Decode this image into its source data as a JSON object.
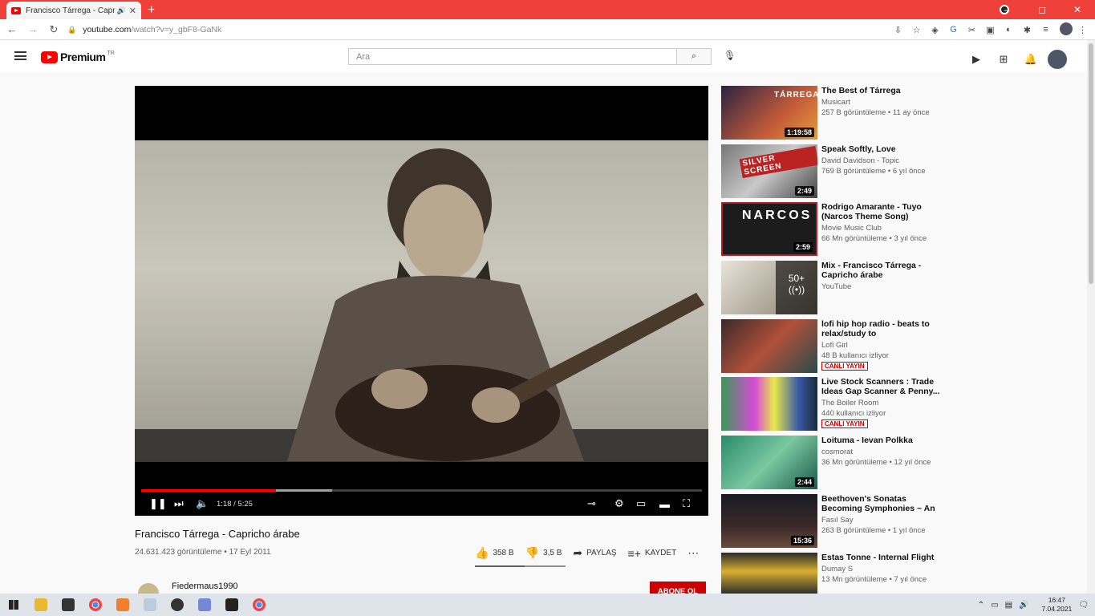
{
  "browser": {
    "tab_title": "Francisco Tárrega - Capricho",
    "url_host": "youtube.com",
    "url_path": "/watch?v=y_gbF8-GaNk",
    "window_controls": [
      "–",
      "◻",
      "✕"
    ]
  },
  "youtube": {
    "logo_text": "Premium",
    "logo_country": "TR",
    "search_placeholder": "Ara"
  },
  "player": {
    "current_time": "1:18",
    "duration": "5:25",
    "time_display": "1:18 / 5:25",
    "progress_fraction": 0.24,
    "buffered_fraction": 0.34
  },
  "video": {
    "title": "Francisco Tárrega - Capricho árabe",
    "meta": "24.631.423 görüntüleme • 17 Eyl 2011",
    "likes": "358 B",
    "dislikes": "3,5 B",
    "share_label": "PAYLAŞ",
    "save_label": "KAYDET",
    "channel": "Fiedermaus1990",
    "subscribe_label": "ABONE OL"
  },
  "recommendations": [
    {
      "title": "The Best of Tárrega",
      "channel": "Musicart",
      "meta": "257 B görüntüleme • 11 ay önce",
      "duration": "1:19:58",
      "thumb_text": "TÁRREGA"
    },
    {
      "title": "Speak Softly, Love",
      "channel": "David Davidson - Topic",
      "meta": "769 B görüntüleme • 6 yıl önce",
      "duration": "2:49",
      "thumb_text": "SILVER SCREEN"
    },
    {
      "title": "Rodrigo Amarante - Tuyo (Narcos Theme Song) [Lyrics...",
      "channel": "Movie Music Club",
      "meta": "66 Mn görüntüleme • 3 yıl önce",
      "duration": "2:59",
      "thumb_text": "NARCOS"
    },
    {
      "title": "Mix - Francisco Tárrega - Capricho árabe",
      "channel": "YouTube",
      "meta": "",
      "duration": "",
      "mix_count": "50+"
    },
    {
      "title": "lofi hip hop radio - beats to relax/study to",
      "channel": "Lofi Girl",
      "meta": "48 B kullanıcı izliyor",
      "live": "CANLI YAYIN"
    },
    {
      "title": "Live Stock Scanners : Trade Ideas Gap Scanner & Penny...",
      "channel": "The Boiler Room",
      "meta": "440 kullanıcı izliyor",
      "live": "CANLI YAYIN"
    },
    {
      "title": "Loituma - Ievan Polkka",
      "channel": "cosmorat",
      "meta": "36 Mn görüntüleme • 12 yıl önce",
      "duration": "2:44"
    },
    {
      "title": "Beethoven's Sonatas Becoming Symphonies ~ An Experiment...",
      "channel": "Fasıl Say",
      "meta": "263 B görüntüleme • 1 yıl önce",
      "duration": "15:36"
    },
    {
      "title": "Estas Tonne - Internal Flight",
      "channel": "Dumay S",
      "meta": "13 Mn görüntüleme • 7 yıl önce",
      "duration": ""
    }
  ],
  "taskbar": {
    "time": "16:47",
    "date": "7.04.2021"
  },
  "colors": {
    "tabstrip": "#f0403a",
    "yt_red": "#ff0000",
    "subscribe": "#cc0000"
  }
}
